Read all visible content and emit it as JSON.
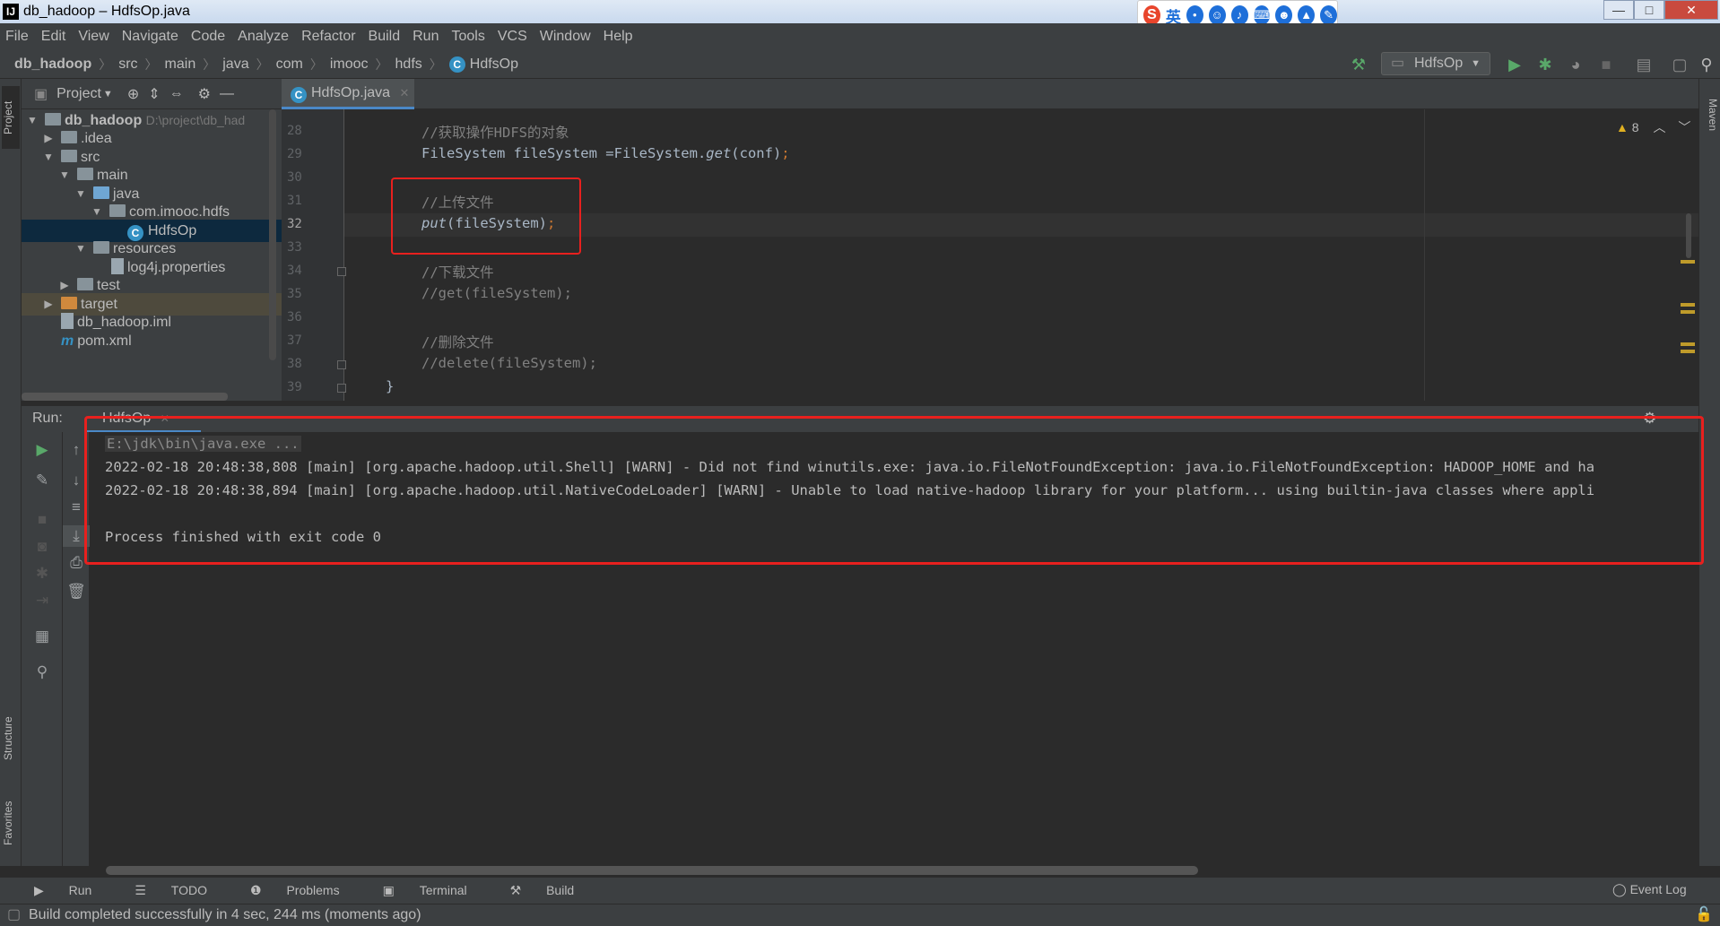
{
  "window": {
    "title": "db_hadoop – HdfsOp.java",
    "app_icon": "intellij-icon",
    "controls": {
      "minimize": "—",
      "maximize": "□",
      "close": "✕"
    }
  },
  "ime_toolbar": {
    "logo": "S",
    "mode": "英",
    "icons": [
      "punctuation-icon",
      "emoji-icon",
      "microphone-icon",
      "keyboard-icon",
      "user-icon",
      "skin-icon",
      "wrench-icon"
    ]
  },
  "menu": [
    "File",
    "Edit",
    "View",
    "Navigate",
    "Code",
    "Analyze",
    "Refactor",
    "Build",
    "Run",
    "Tools",
    "VCS",
    "Window",
    "Help"
  ],
  "breadcrumb": [
    "db_hadoop",
    "src",
    "main",
    "java",
    "com",
    "imooc",
    "hdfs",
    "HdfsOp"
  ],
  "run_config": "HdfsOp",
  "left_tool_tabs": {
    "project": "Project",
    "structure": "Structure",
    "favorites": "Favorites"
  },
  "right_tool_tabs": {
    "maven": "Maven"
  },
  "project_panel": {
    "title": "Project",
    "tree": [
      {
        "label": "db_hadoop",
        "extra": "D:\\project\\db_had"
      },
      {
        "label": ".idea"
      },
      {
        "label": "src"
      },
      {
        "label": "main"
      },
      {
        "label": "java"
      },
      {
        "label": "com.imooc.hdfs"
      },
      {
        "label": "HdfsOp"
      },
      {
        "label": "resources"
      },
      {
        "label": "log4j.properties"
      },
      {
        "label": "test"
      },
      {
        "label": "target"
      },
      {
        "label": "db_hadoop.iml"
      },
      {
        "label": "pom.xml"
      }
    ]
  },
  "editor": {
    "tab": "HdfsOp.java",
    "inspections": {
      "warnings": "8"
    },
    "current_line": "32",
    "lines": [
      {
        "no": "28",
        "text": "//获取操作HDFS的对象"
      },
      {
        "no": "29",
        "text": "FileSystem fileSystem =FileSystem.",
        "method": "get",
        "tail": "(conf)",
        "semi": ";"
      },
      {
        "no": "30",
        "text": ""
      },
      {
        "no": "31",
        "text": "//上传文件"
      },
      {
        "no": "32",
        "method": "put",
        "tail": "(fileSystem)",
        "semi": ";"
      },
      {
        "no": "33",
        "text": ""
      },
      {
        "no": "34",
        "text": "//下载文件"
      },
      {
        "no": "35",
        "text": "//get(fileSystem);"
      },
      {
        "no": "36",
        "text": ""
      },
      {
        "no": "37",
        "text": "//删除文件"
      },
      {
        "no": "38",
        "text": "//delete(fileSystem);"
      },
      {
        "no": "39",
        "text": "}"
      }
    ]
  },
  "run_panel": {
    "label": "Run:",
    "tab": "HdfsOp",
    "console": [
      "E:\\jdk\\bin\\java.exe ...",
      "2022-02-18 20:48:38,808 [main] [org.apache.hadoop.util.Shell] [WARN] - Did not find winutils.exe: java.io.FileNotFoundException: java.io.FileNotFoundException: HADOOP_HOME and ha",
      "2022-02-18 20:48:38,894 [main] [org.apache.hadoop.util.NativeCodeLoader] [WARN] - Unable to load native-hadoop library for your platform... using builtin-java classes where appli",
      "",
      "Process finished with exit code 0"
    ]
  },
  "bottom_tabs": [
    "Run",
    "TODO",
    "Problems",
    "Terminal",
    "Build"
  ],
  "event_log": "Event Log",
  "status": "Build completed successfully in 4 sec, 244 ms (moments ago)",
  "colors": {
    "highlight_box": "#e8201e",
    "background": "#2b2b2b",
    "panel": "#3c3f41",
    "comment": "#808080",
    "keyword": "#cc7832",
    "selection": "#0d293e"
  }
}
